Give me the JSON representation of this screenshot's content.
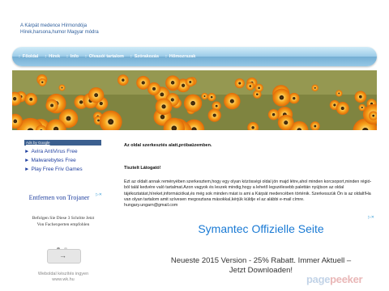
{
  "site": {
    "title_line1": "A Kárpát medence Hírmondója",
    "title_line2": "Hírek,harsona,humor Magyar módra"
  },
  "nav": {
    "items": [
      "Főoldal",
      "Hírek",
      "Info",
      "Olvasói tartalom",
      "Szórakozás",
      "Hőmozrszak"
    ]
  },
  "sidebar": {
    "ads_label": "Ads by Google",
    "links": [
      "Avira AntiVirus Free",
      "Malwarebytes Free",
      "Play Free Friv Games"
    ]
  },
  "ad1": {
    "title": "Entfernen von Trojaner",
    "text": "Befolgen Sie Diese 3 Schritte Jetzt Von Fachexperten empfohlen",
    "button_arrow": "→"
  },
  "footer": {
    "line1": "Weboldal készítés ingyen",
    "line2": "www.wk.hu"
  },
  "main": {
    "heading": "Az oldal szerkesztés alatt,próbaüzemben.",
    "greeting": "Tisztelt Látogató!",
    "body": "Ezt az oldalt annak reményében szerkesztem,hogy egy olyan közösségi oldal jön majd létre,ahol minden korcsoport,minden régió-ból talál kedvére való tartalmat.Azon vagyok és leszek mindig,hogy a lehető legszélesebb palettán nyújtson az oldal tájékoztatást,híreket,információkat,és még sok minden mást is ami a Kárpát medencében történik. Szerkesszük Ön is az oldalt!Ha van olyan tartalom amit szívesen megosztana másokkal,kérjük küldje el az alábbi e-mail címre.",
    "email": "hungary.ungarn@gmail.com"
  },
  "ad2": {
    "title": "Symantec Offizielle Seite",
    "desc": "Neueste 2015 Version - 25% Rabatt. Immer Aktuell – Jetzt Downloaden!"
  },
  "watermark": {
    "part1": "page",
    "part2": "peeker"
  },
  "colors": {
    "nav_bg": "#8cc3e3",
    "link": "#1f3f9f",
    "ad_title": "#1a7ad4",
    "title": "#2e5e9c"
  }
}
